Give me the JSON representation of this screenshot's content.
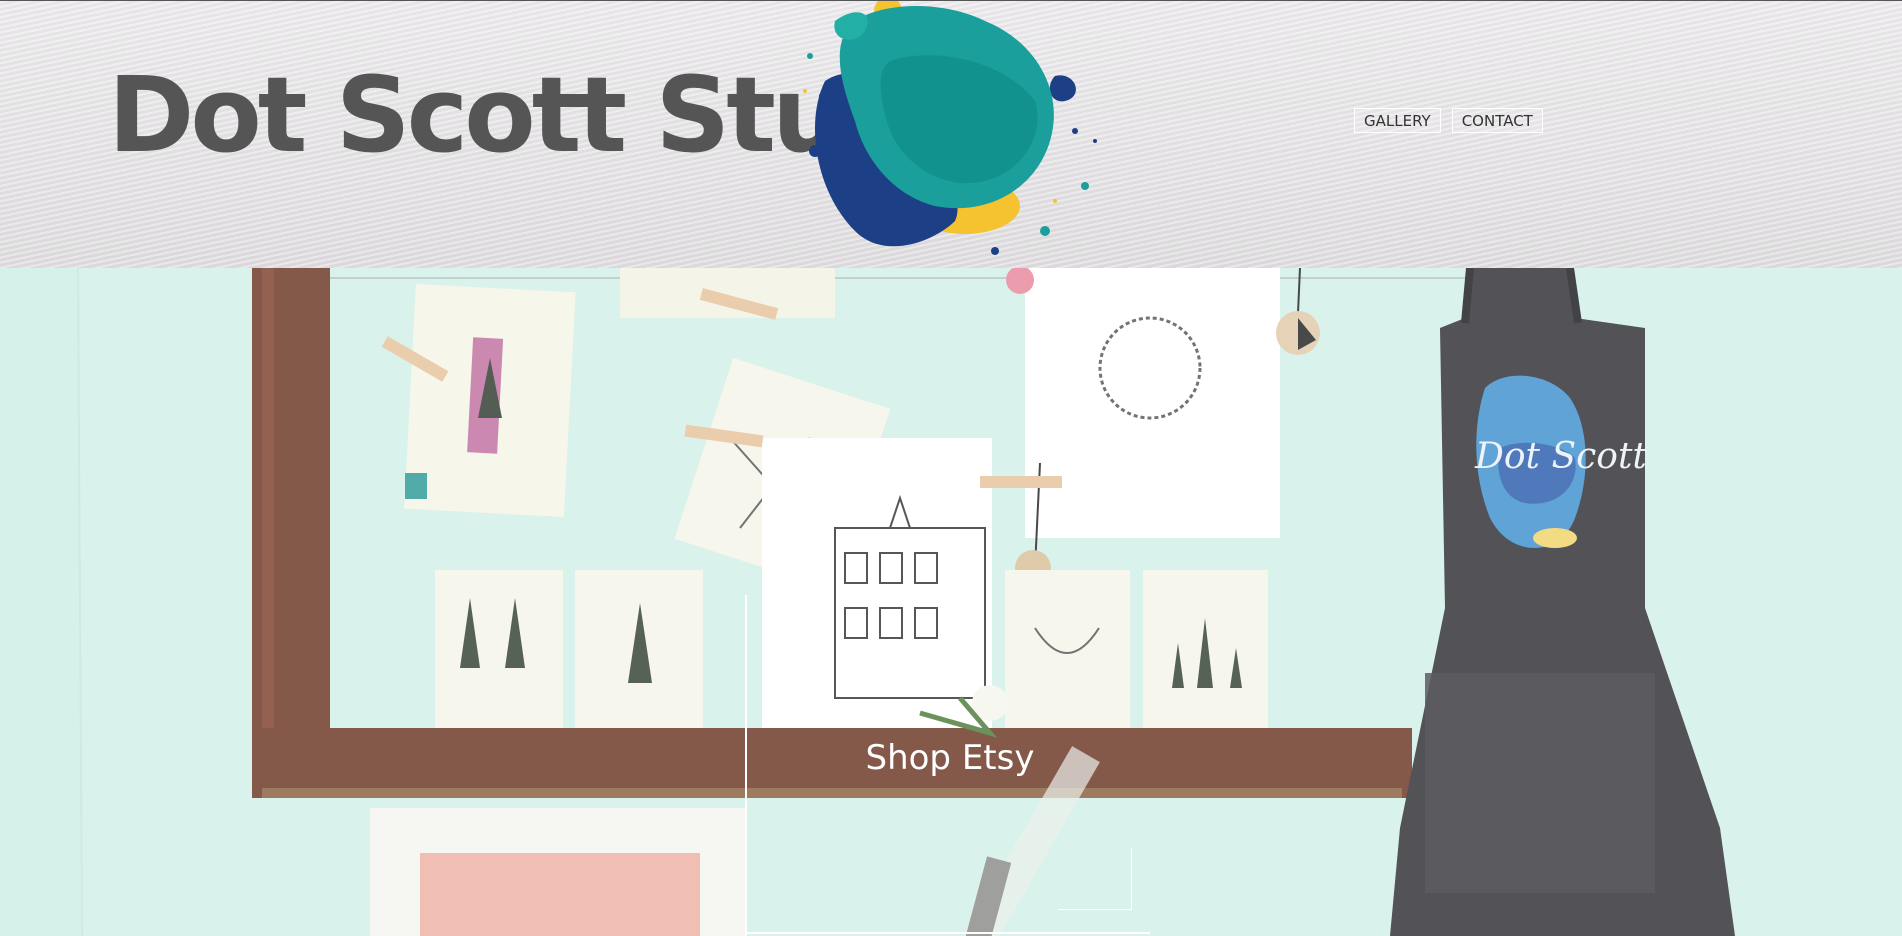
{
  "header": {
    "site_title": "Dot Scott Studio",
    "logo_icon": "paint-splash-logo",
    "nav": [
      {
        "label": "GALLERY"
      },
      {
        "label": "CONTACT"
      }
    ]
  },
  "hero": {
    "cta_label": "Shop Etsy",
    "apron_text": "Dot Scott"
  },
  "colors": {
    "title": "#555555",
    "teal": "#1a9f9c",
    "navy": "#1d3f86",
    "yellow": "#f5c230",
    "wall": "#d2f0e8",
    "frame_wood": "#6b2f1e",
    "apron": "#2a2a30"
  }
}
